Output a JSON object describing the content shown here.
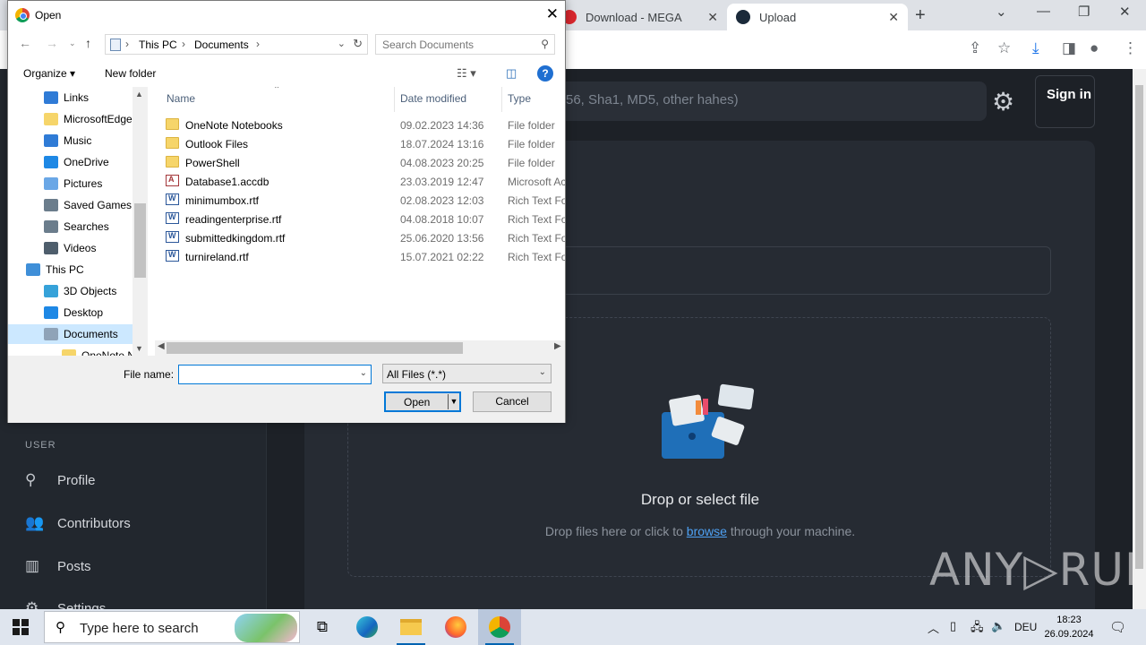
{
  "browser": {
    "tabs": [
      {
        "label": "Download - MEGA",
        "active": false
      },
      {
        "label": "Upload",
        "active": true
      }
    ],
    "new_tab": "+",
    "window_controls": [
      "minimize",
      "restore",
      "close"
    ]
  },
  "page": {
    "search_placeholder": "56, Sha1, MD5, other hahes)",
    "sign_in": "Sign in",
    "drop_title": "Drop or select file",
    "drop_sub_before": "Drop files here or click to",
    "drop_sub_link": "browse",
    "drop_sub_after": "through your machine.",
    "sidebar_section": "USER",
    "sidebar_items": [
      "Profile",
      "Contributors",
      "Posts",
      "Settings"
    ],
    "watermark": "ANY▷RUN"
  },
  "dialog": {
    "title": "Open",
    "breadcrumb": [
      "This PC",
      "Documents"
    ],
    "search_placeholder": "Search Documents",
    "organize": "Organize ▾",
    "new_folder": "New folder",
    "help": "?",
    "tree": [
      {
        "label": "Links",
        "indent": 2,
        "color": "#2f7bd6"
      },
      {
        "label": "MicrosoftEdge",
        "indent": 2,
        "color": "#f6d56a"
      },
      {
        "label": "Music",
        "indent": 2,
        "color": "#2f7bd6"
      },
      {
        "label": "OneDrive",
        "indent": 2,
        "color": "#1e88e5"
      },
      {
        "label": "Pictures",
        "indent": 2,
        "color": "#6aa7e6"
      },
      {
        "label": "Saved Games",
        "indent": 2,
        "color": "#6b7d8c"
      },
      {
        "label": "Searches",
        "indent": 2,
        "color": "#6b7d8c"
      },
      {
        "label": "Videos",
        "indent": 2,
        "color": "#4e5e6c"
      },
      {
        "label": "This PC",
        "indent": 1,
        "color": "#3f8fd8"
      },
      {
        "label": "3D Objects",
        "indent": 2,
        "color": "#36a2d9"
      },
      {
        "label": "Desktop",
        "indent": 2,
        "color": "#1e88e5"
      },
      {
        "label": "Documents",
        "indent": 2,
        "color": "#8fa3b8",
        "selected": true
      },
      {
        "label": "OneNote Not",
        "indent": 3,
        "color": "#f6d56a"
      }
    ],
    "columns": {
      "name": "Name",
      "date": "Date modified",
      "type": "Type"
    },
    "files": [
      {
        "name": "OneNote Notebooks",
        "date": "09.02.2023 14:36",
        "type": "File folder",
        "icon": "folder"
      },
      {
        "name": "Outlook Files",
        "date": "18.07.2024 13:16",
        "type": "File folder",
        "icon": "folder"
      },
      {
        "name": "PowerShell",
        "date": "04.08.2023 20:25",
        "type": "File folder",
        "icon": "folder"
      },
      {
        "name": "Database1.accdb",
        "date": "23.03.2019 12:47",
        "type": "Microsoft Ac",
        "icon": "access"
      },
      {
        "name": "minimumbox.rtf",
        "date": "02.08.2023 12:03",
        "type": "Rich Text For",
        "icon": "rtf"
      },
      {
        "name": "readingenterprise.rtf",
        "date": "04.08.2018 10:07",
        "type": "Rich Text For",
        "icon": "rtf"
      },
      {
        "name": "submittedkingdom.rtf",
        "date": "25.06.2020 13:56",
        "type": "Rich Text For",
        "icon": "rtf"
      },
      {
        "name": "turnireland.rtf",
        "date": "15.07.2021 02:22",
        "type": "Rich Text For",
        "icon": "rtf"
      }
    ],
    "file_name_label": "File name:",
    "file_name_value": "",
    "file_type": "All Files (*.*)",
    "open_button": "Open",
    "cancel_button": "Cancel"
  },
  "taskbar": {
    "search_placeholder": "Type here to search",
    "language": "DEU",
    "time": "18:23",
    "date": "26.09.2024"
  }
}
